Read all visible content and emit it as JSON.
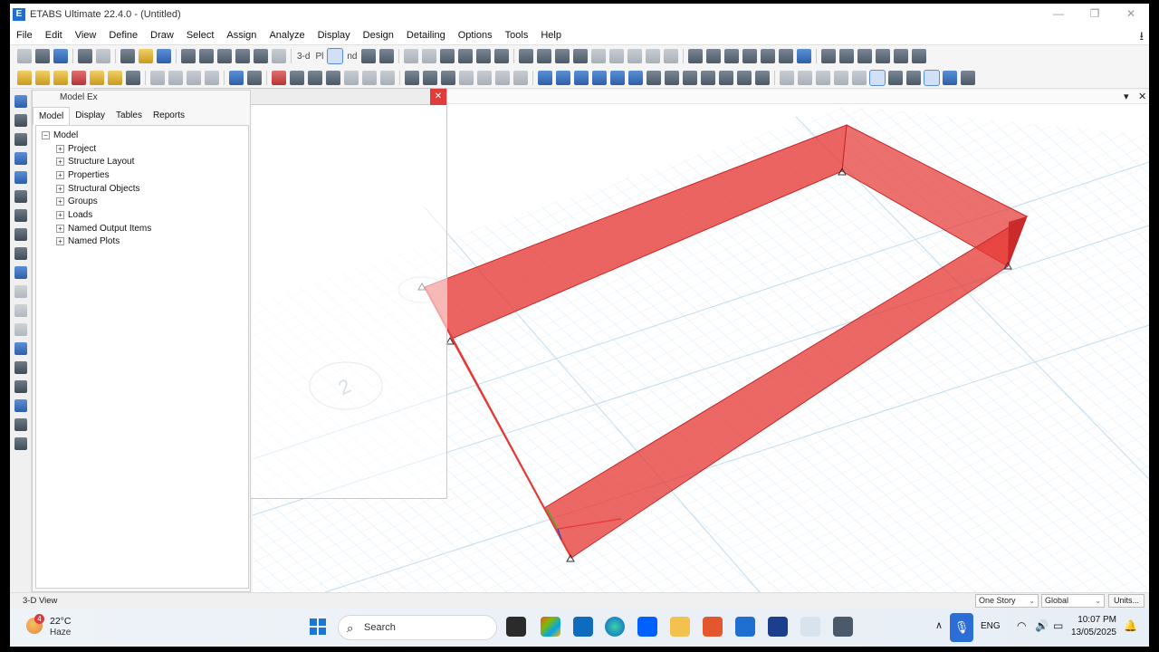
{
  "window": {
    "title": "ETABS Ultimate 22.4.0 - (Untitled)",
    "app_icon": "E",
    "minimize": "—",
    "restore": "❐",
    "close": "✕"
  },
  "menu": [
    "File",
    "Edit",
    "View",
    "Define",
    "Draw",
    "Select",
    "Assign",
    "Analyze",
    "Display",
    "Design",
    "Detailing",
    "Options",
    "Tools",
    "Help"
  ],
  "toolbar": {
    "view_3d": "3-d",
    "view_plan": "Pl",
    "view_elev": "nd"
  },
  "explorer": {
    "title": "Model Ex",
    "tabs": [
      "Model",
      "Display",
      "Tables",
      "Reports"
    ],
    "root": "Model",
    "items": [
      "Project",
      "Structure Layout",
      "Properties",
      "Structural Objects",
      "Groups",
      "Loads",
      "Named Output Items",
      "Named Plots"
    ]
  },
  "viewport": {
    "grid_label": "2",
    "wall_color": "#e53935",
    "grid_color": "#b9d8ee",
    "restore_label": "▾",
    "close_label": "✕"
  },
  "statusbar": {
    "text": "3-D View",
    "story": "One Story",
    "coord": "Global",
    "units": "Units..."
  },
  "taskbar": {
    "weather_temp": "22°C",
    "weather_cond": "Haze",
    "weather_badge": "4",
    "search": "Search",
    "lang": "ENG",
    "time": "10:07 PM",
    "date": "13/05/2025"
  }
}
